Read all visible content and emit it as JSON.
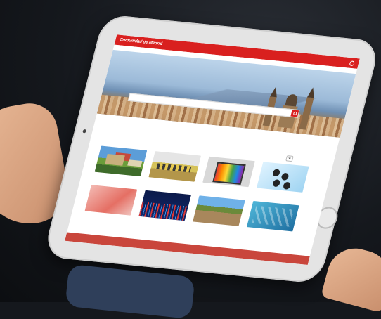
{
  "header": {
    "brand": "Comunidad de Madrid",
    "nav": [
      "",
      "",
      "",
      ""
    ]
  },
  "sub_nav": {
    "link": ""
  },
  "hero": {
    "title": "",
    "search_placeholder": ""
  },
  "content": {
    "alert": "",
    "section_label": ""
  },
  "cards": [
    {
      "caption": "",
      "icon": "castle-photo"
    },
    {
      "caption": "",
      "icon": "classroom-photo"
    },
    {
      "caption": "",
      "icon": "monitor-photo"
    },
    {
      "caption": "",
      "icon": "network-photo"
    },
    {
      "caption": "",
      "icon": "abstract-photo"
    },
    {
      "caption": "",
      "icon": "stock-chart-photo"
    },
    {
      "caption": "",
      "icon": "field-photo"
    },
    {
      "caption": "",
      "icon": "hexagon-photo"
    }
  ],
  "colors": {
    "brand_red": "#d9201f",
    "tablet_frame": "#e4e4e4",
    "background": "#15181d"
  }
}
